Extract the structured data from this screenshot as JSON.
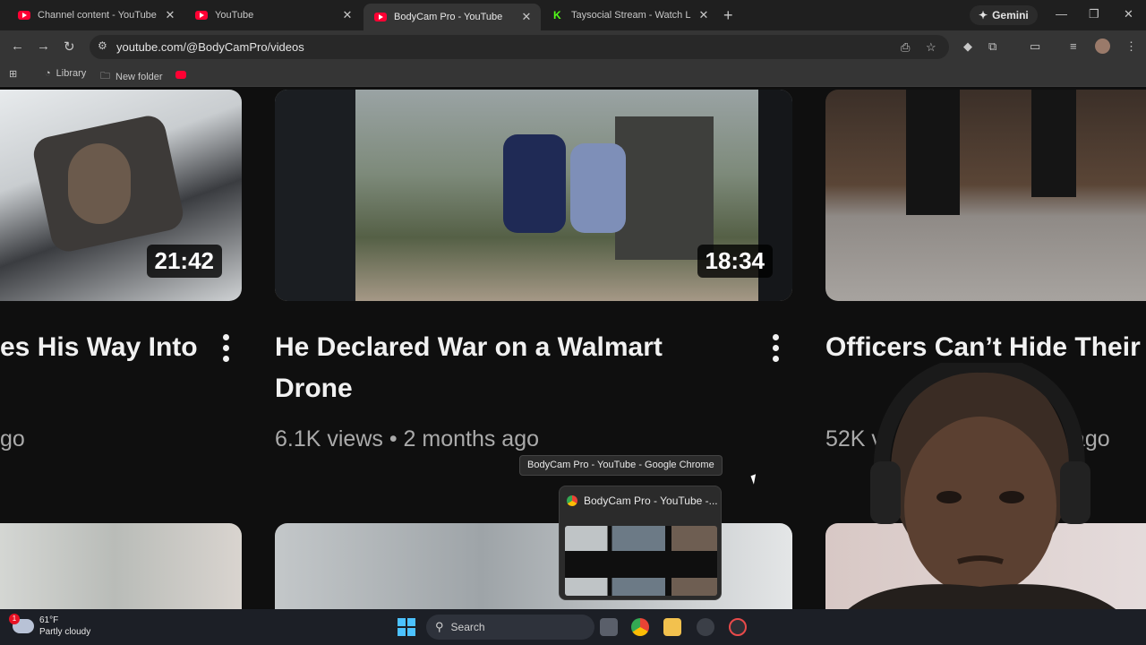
{
  "browser": {
    "tabs": [
      {
        "title": "Channel content - YouTube Stu",
        "icon": "youtube-icon",
        "active": false
      },
      {
        "title": "YouTube",
        "icon": "youtube-icon",
        "active": false
      },
      {
        "title": "BodyCam Pro - YouTube",
        "icon": "youtube-icon",
        "active": true
      },
      {
        "title": "Taysocial Stream - Watch Live o",
        "icon": "kick-icon",
        "active": false
      }
    ],
    "new_tab_symbol": "+",
    "gemini_label": "Gemini",
    "url": "youtube.com/@BodyCamPro/videos",
    "bookmarks": [
      {
        "label": "Library",
        "icon": "library-icon"
      },
      {
        "label": "New folder",
        "icon": "folder-icon"
      }
    ]
  },
  "videos": {
    "row1": [
      {
        "title": "es His Way Into",
        "meta": "go",
        "duration": "21:42"
      },
      {
        "title": "He Declared War on a Walmart Drone",
        "meta": "6.1K views • 2 months ago",
        "duration": "18:34"
      },
      {
        "title": "Officers Can’t Hide Their This En",
        "meta_left": "52K vi",
        "meta_right": "ago",
        "duration": ""
      }
    ]
  },
  "hover": {
    "tooltip": "BodyCam Pro - YouTube - Google Chrome",
    "preview_title": "BodyCam Pro - YouTube -..."
  },
  "taskbar": {
    "weather_temp": "61°F",
    "weather_desc": "Partly cloudy",
    "weather_badge": "1",
    "search_label": "Search"
  },
  "colors": {
    "youtube_red": "#ff0033",
    "background": "#0f0f0f",
    "meta_text": "#aaaaaa"
  }
}
